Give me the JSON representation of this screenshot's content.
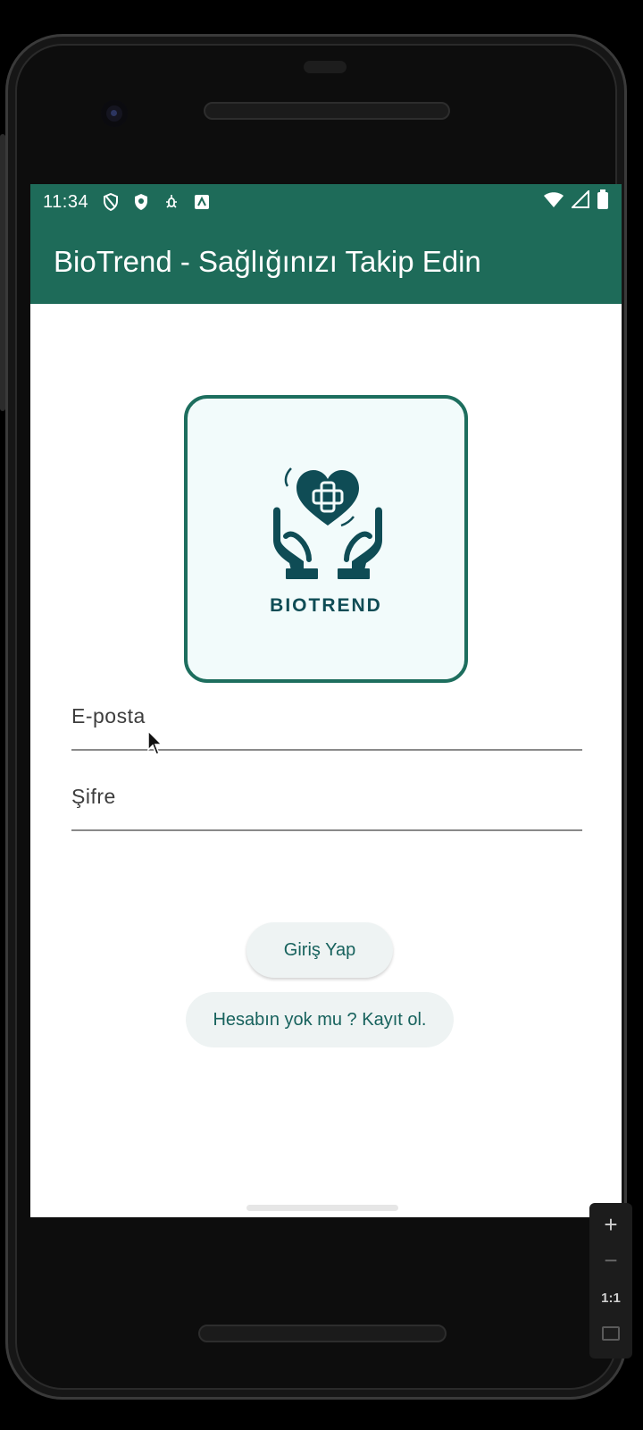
{
  "status_bar": {
    "time": "11:34"
  },
  "app_bar": {
    "title": "BioTrend - Sağlığınızı Takip Edin"
  },
  "logo": {
    "text": "BIOTREND",
    "icon": "heart-in-hands-icon"
  },
  "form": {
    "email_label": "E-posta",
    "password_label": "Şifre"
  },
  "buttons": {
    "login": "Giriş Yap",
    "register": "Hesabın yok mu ? Kayıt ol."
  },
  "emulator_controls": {
    "zoom_in": "+",
    "zoom_out": "−",
    "ratio": "1:1"
  },
  "colors": {
    "primary": "#1e6b59",
    "logo_border": "#1d6e5e",
    "logo_text": "#0f4c55",
    "button_text": "#17625d",
    "button_bg": "#eef3f3"
  }
}
